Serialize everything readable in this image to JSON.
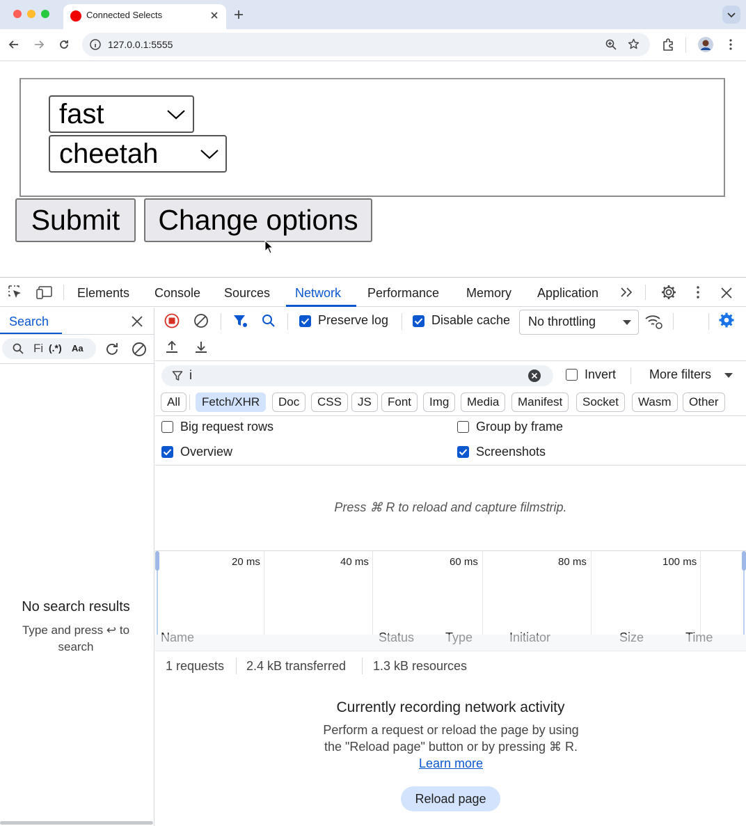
{
  "browser": {
    "tab_title": "Connected Selects",
    "url": "127.0.0.1:5555"
  },
  "page": {
    "select_speed": "fast",
    "select_animal": "cheetah",
    "submit_label": "Submit",
    "change_options_label": "Change options"
  },
  "devtools": {
    "tabs": [
      "Elements",
      "Console",
      "Sources",
      "Network",
      "Performance",
      "Memory",
      "Application"
    ],
    "active_tab": "Network",
    "search": {
      "title": "Search",
      "input_placeholder": "Fi",
      "regex_label": "(.*)",
      "case_label": "Aa",
      "no_results": "No search results",
      "hint": "Type and press ↩ to search"
    },
    "network": {
      "preserve_log": "Preserve log",
      "disable_cache": "Disable cache",
      "throttling": "No throttling",
      "filter_value": "i",
      "invert": "Invert",
      "more_filters": "More filters",
      "chips": [
        "All",
        "Fetch/XHR",
        "Doc",
        "CSS",
        "JS",
        "Font",
        "Img",
        "Media",
        "Manifest",
        "Socket",
        "Wasm",
        "Other"
      ],
      "active_chip": "Fetch/XHR",
      "big_request_rows": "Big request rows",
      "group_by_frame": "Group by frame",
      "overview": "Overview",
      "screenshots": "Screenshots",
      "filmstrip_msg": "Press ⌘ R to reload and capture filmstrip.",
      "timeline_labels": [
        "20 ms",
        "40 ms",
        "60 ms",
        "80 ms",
        "100 ms"
      ],
      "columns": [
        "Name",
        "Status",
        "Type",
        "Initiator",
        "Size",
        "Time"
      ],
      "summary": [
        "1 requests",
        "2.4 kB transferred",
        "1.3 kB resources"
      ],
      "recording_title": "Currently recording network activity",
      "recording_text": "Perform a request or reload the page by using the \"Reload page\" button or by pressing ⌘ R.",
      "learn_more": "Learn more",
      "reload_label": "Reload page"
    }
  }
}
